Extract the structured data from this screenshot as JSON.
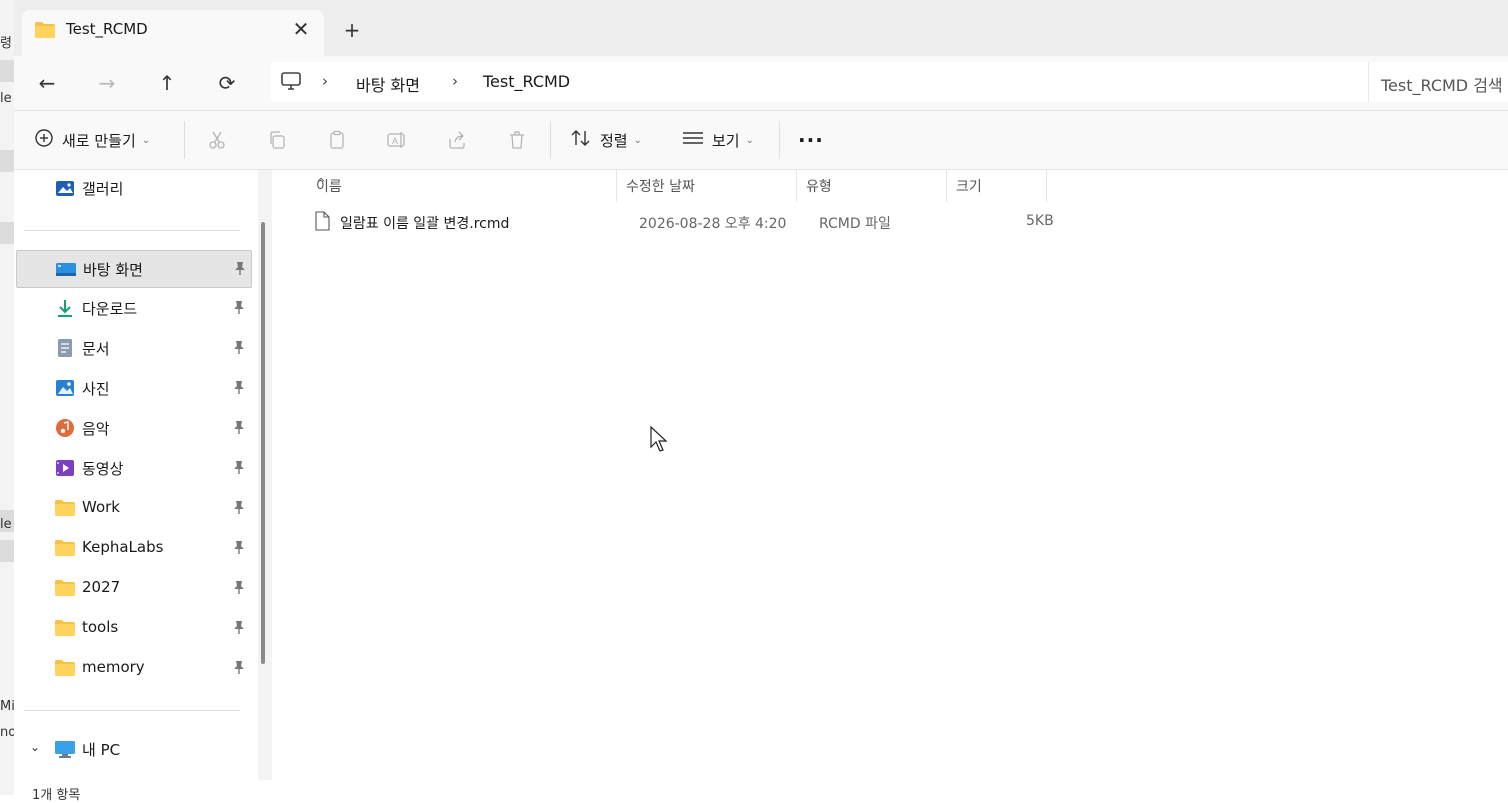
{
  "background_window": {
    "fragments": [
      "령",
      "le",
      "le",
      "Mi",
      "no"
    ]
  },
  "tab": {
    "title": "Test_RCMD",
    "close_glyph": "✕",
    "new_tab_glyph": "+"
  },
  "nav": {
    "back_glyph": "←",
    "forward_glyph": "→",
    "up_glyph": "↑",
    "refresh_glyph": "⟳"
  },
  "breadcrumb": {
    "chevron": "›",
    "items": [
      "바탕 화면",
      "Test_RCMD"
    ]
  },
  "search": {
    "placeholder": "Test_RCMD 검색"
  },
  "toolbar": {
    "new_label": "새로 만들기",
    "sort_label": "정렬",
    "view_label": "보기",
    "caret": "⌄",
    "more_label": "···"
  },
  "sidebar": {
    "gallery": "갤러리",
    "quick_access": [
      {
        "label": "바탕 화면",
        "icon": "desktop-icon",
        "pinned": true,
        "selected": true
      },
      {
        "label": "다운로드",
        "icon": "download-icon",
        "pinned": true
      },
      {
        "label": "문서",
        "icon": "document-icon",
        "pinned": true
      },
      {
        "label": "사진",
        "icon": "pictures-icon",
        "pinned": true
      },
      {
        "label": "음악",
        "icon": "music-icon",
        "pinned": true
      },
      {
        "label": "동영상",
        "icon": "video-icon",
        "pinned": true
      },
      {
        "label": "Work",
        "icon": "folder-icon",
        "pinned": true
      },
      {
        "label": "KephaLabs",
        "icon": "folder-icon",
        "pinned": true
      },
      {
        "label": "2027",
        "icon": "folder-icon",
        "pinned": true
      },
      {
        "label": "tools",
        "icon": "folder-icon",
        "pinned": true
      },
      {
        "label": "memory",
        "icon": "folder-icon",
        "pinned": true
      }
    ],
    "this_pc": "내 PC",
    "expand_glyph": "⌄"
  },
  "columns": {
    "name": "이름",
    "modified": "수정한 날짜",
    "type": "유형",
    "size": "크기",
    "sort_glyph": "^"
  },
  "files": [
    {
      "name": "일람표 이름 일괄 변경.rcmd",
      "modified": "2026-08-28 오후 4:20",
      "type": "RCMD 파일",
      "size": "5KB"
    }
  ],
  "status": {
    "text": "1개 항목"
  },
  "colors": {
    "folder": "#f5c242",
    "accent": "#0067c0",
    "selected_bg": "#e5e5e5"
  }
}
